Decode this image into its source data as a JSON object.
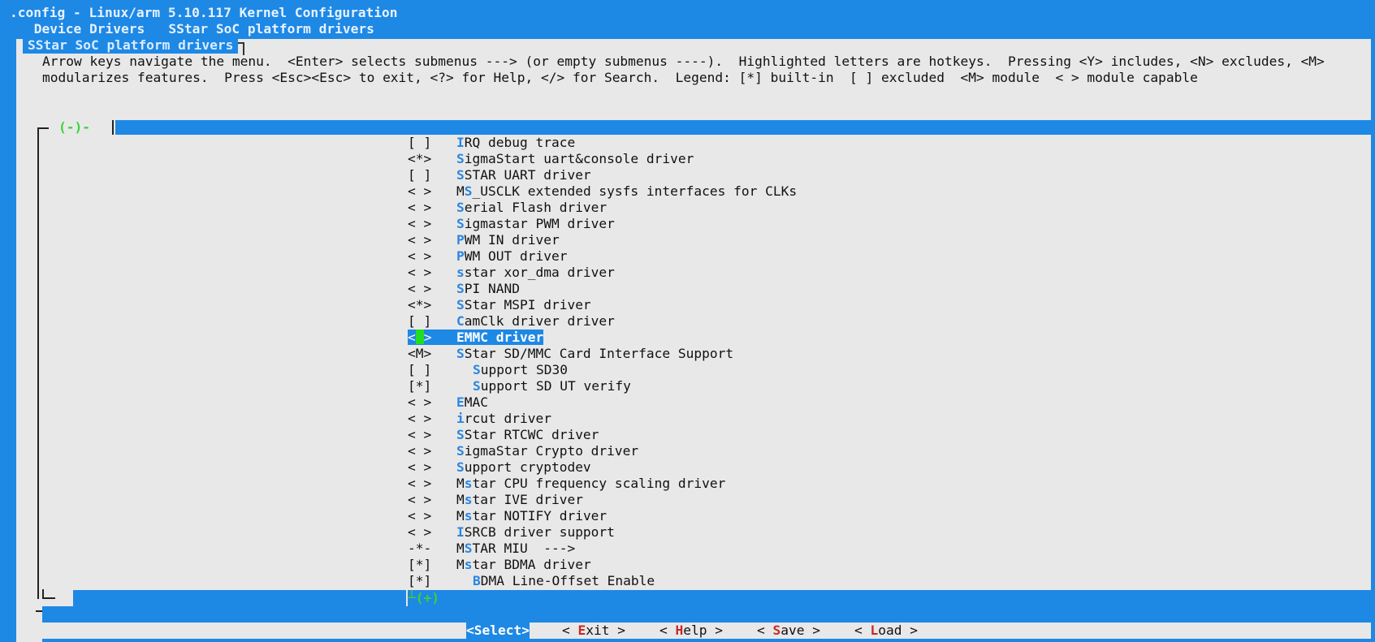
{
  "header": {
    "title": ".config - Linux/arm 5.10.117 Kernel Configuration",
    "breadcrumb": " Device Drivers   SStar SoC platform drivers"
  },
  "dialog": {
    "title": "SStar SoC platform drivers",
    "help_line_1": "Arrow keys navigate the menu.  <Enter> selects submenus ---> (or empty submenus ----).  Highlighted letters are hotkeys.  Pressing <Y> includes, <N> excludes, <M>",
    "help_line_2": "modularizes features.  Press <Esc><Esc> to exit, <?> for Help, </> for Search.  Legend: [*] built-in  [ ] excluded  <M> module  < > module capable",
    "scroll_up": "(-)-",
    "scroll_down": "┴(+)"
  },
  "items": [
    {
      "mark": "[ ]",
      "hotkey": "I",
      "rest": "RQ debug trace",
      "pre": ""
    },
    {
      "mark": "<*>",
      "hotkey": "S",
      "rest": "igmaStart uart&console driver",
      "pre": ""
    },
    {
      "mark": "[ ]",
      "hotkey": "S",
      "rest": "STAR UART driver",
      "pre": ""
    },
    {
      "mark": "< >",
      "hotkey": "S",
      "rest": "_USCLK extended sysfs interfaces for CLKs",
      "pre": "M"
    },
    {
      "mark": "< >",
      "hotkey": "S",
      "rest": "erial Flash driver",
      "pre": ""
    },
    {
      "mark": "< >",
      "hotkey": "S",
      "rest": "igmastar PWM driver",
      "pre": ""
    },
    {
      "mark": "< >",
      "hotkey": "P",
      "rest": "WM IN driver",
      "pre": ""
    },
    {
      "mark": "< >",
      "hotkey": "P",
      "rest": "WM OUT driver",
      "pre": ""
    },
    {
      "mark": "< >",
      "hotkey": "s",
      "rest": "star xor_dma driver",
      "pre": ""
    },
    {
      "mark": "< >",
      "hotkey": "S",
      "rest": "PI NAND",
      "pre": ""
    },
    {
      "mark": "<*>",
      "hotkey": "S",
      "rest": "Star MSPI driver",
      "pre": ""
    },
    {
      "mark": "[ ]",
      "hotkey": "C",
      "rest": "amClk driver driver",
      "pre": ""
    },
    {
      "mark": "< >",
      "hotkey": "E",
      "rest": "MMC driver",
      "pre": ""
    },
    {
      "mark": "<M>",
      "hotkey": "S",
      "rest": "Star SD/MMC Card Interface Support",
      "pre": ""
    },
    {
      "mark": "[ ]",
      "hotkey": "S",
      "rest": "upport SD30",
      "pre": ""
    },
    {
      "mark": "[*]",
      "hotkey": "S",
      "rest": "upport SD UT verify",
      "pre": ""
    },
    {
      "mark": "< >",
      "hotkey": "E",
      "rest": "MAC",
      "pre": ""
    },
    {
      "mark": "< >",
      "hotkey": "i",
      "rest": "rcut driver",
      "pre": ""
    },
    {
      "mark": "< >",
      "hotkey": "S",
      "rest": "Star RTCWC driver",
      "pre": ""
    },
    {
      "mark": "< >",
      "hotkey": "S",
      "rest": "igmaStar Crypto driver",
      "pre": ""
    },
    {
      "mark": "< >",
      "hotkey": "S",
      "rest": "upport cryptodev",
      "pre": ""
    },
    {
      "mark": "< >",
      "hotkey": "s",
      "rest": "tar CPU frequency scaling driver",
      "pre": "M"
    },
    {
      "mark": "< >",
      "hotkey": "s",
      "rest": "tar IVE driver",
      "pre": "M"
    },
    {
      "mark": "< >",
      "hotkey": "s",
      "rest": "tar NOTIFY driver",
      "pre": "M"
    },
    {
      "mark": "< >",
      "hotkey": "I",
      "rest": "SRCB driver support",
      "pre": ""
    },
    {
      "mark": "-*-",
      "hotkey": "S",
      "rest": "TAR MIU  --->",
      "pre": "M"
    },
    {
      "mark": "[*]",
      "hotkey": "s",
      "rest": "tar BDMA driver",
      "pre": "M"
    },
    {
      "mark": "[*]",
      "hotkey": "B",
      "rest": "DMA Line-Offset Enable",
      "pre": ""
    }
  ],
  "buttons": {
    "select": {
      "left": "<",
      "hotkey": "S",
      "rest": "elect>"
    },
    "exit": {
      "left": "< ",
      "hotkey": "E",
      "rest": "xit >"
    },
    "help": {
      "left": "< ",
      "hotkey": "H",
      "rest": "elp >"
    },
    "save": {
      "left": "< ",
      "hotkey": "S",
      "rest": "ave >"
    },
    "load": {
      "left": "< ",
      "hotkey": "L",
      "rest": "oad >"
    }
  },
  "colors": {
    "background_blue": "#1e88e5",
    "dialog_gray": "#e8e8e8",
    "hotkey_blue": "#2a86e0",
    "button_hotkey_red": "#c62828",
    "scroll_indicator_green": "#37d437"
  }
}
